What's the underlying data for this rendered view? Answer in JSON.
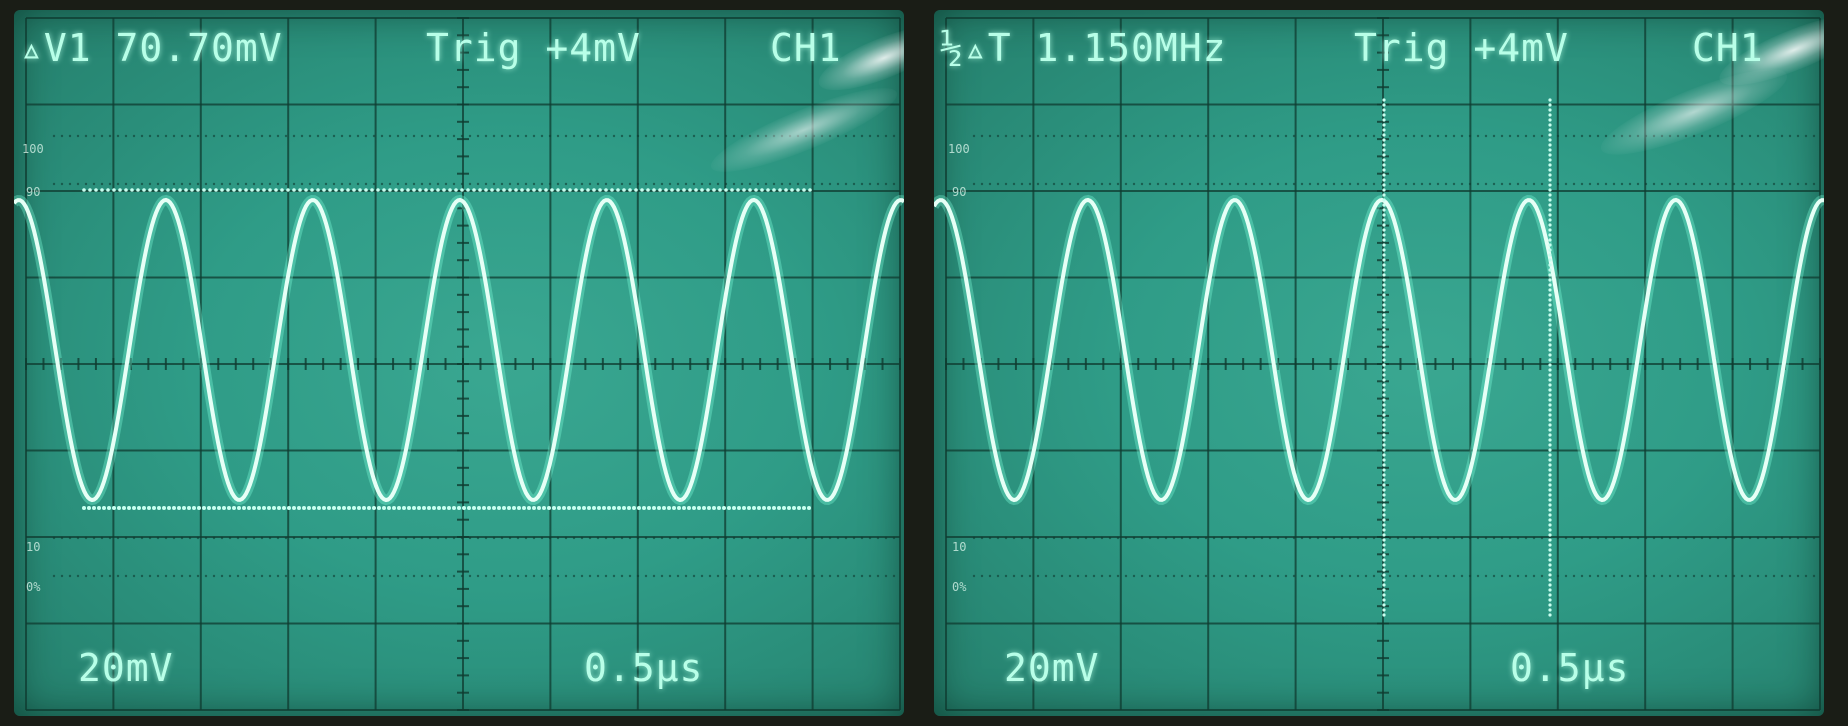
{
  "left": {
    "measure": "▵V1 70.70mV",
    "trigger": "Trig +4mV",
    "channel": "CH1",
    "vscale": "20mV",
    "hscale": "0.5μs",
    "graticule": {
      "p100": "100",
      "p90": "90",
      "p10": "10",
      "p0": "0%"
    }
  },
  "right": {
    "measure": "½▵T 1.150MHz",
    "trigger": "Trig +4mV",
    "channel": "CH1",
    "vscale": "20mV",
    "hscale": "0.5μs",
    "graticule": {
      "p100": "100",
      "p90": "90",
      "p10": "10",
      "p0": "0%"
    }
  },
  "colors": {
    "trace": "#e6fff6",
    "grid": "#0f3b30",
    "text": "#b8ffe8"
  }
}
